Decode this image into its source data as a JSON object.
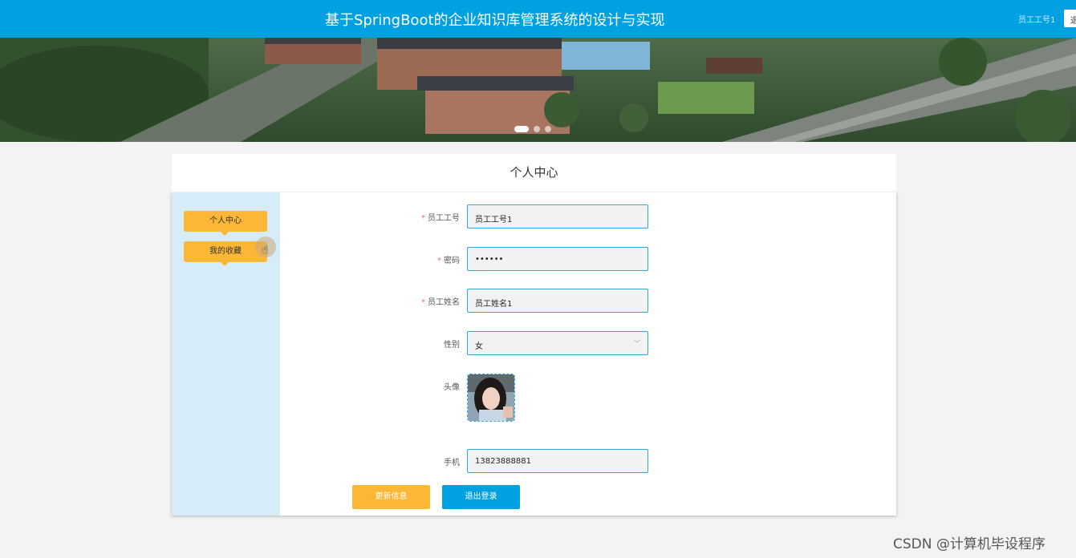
{
  "header": {
    "title": "基于SpringBoot的企业知识库管理系统的设计与实现",
    "user": "员工工号1",
    "logout_mini": "退"
  },
  "panel_title": "个人中心",
  "sidebar": {
    "items": [
      {
        "label": "个人中心"
      },
      {
        "label": "我的收藏"
      }
    ]
  },
  "form": {
    "employee_id": {
      "label": "员工工号",
      "value": "员工工号1"
    },
    "password": {
      "label": "密码",
      "value": "••••••"
    },
    "employee_name": {
      "label": "员工姓名",
      "value": "员工姓名1"
    },
    "gender": {
      "label": "性别",
      "value": "女"
    },
    "avatar": {
      "label": "头像"
    },
    "phone": {
      "label": "手机",
      "value": "13823888881"
    }
  },
  "buttons": {
    "update": "更新信息",
    "logout": "退出登录"
  },
  "watermark": "CSDN @计算机毕设程序",
  "colors": {
    "header": "#00a1e0",
    "accent_orange": "#fdb737",
    "sidebar": "#d6edf9",
    "field_border": "#31a8e0"
  }
}
